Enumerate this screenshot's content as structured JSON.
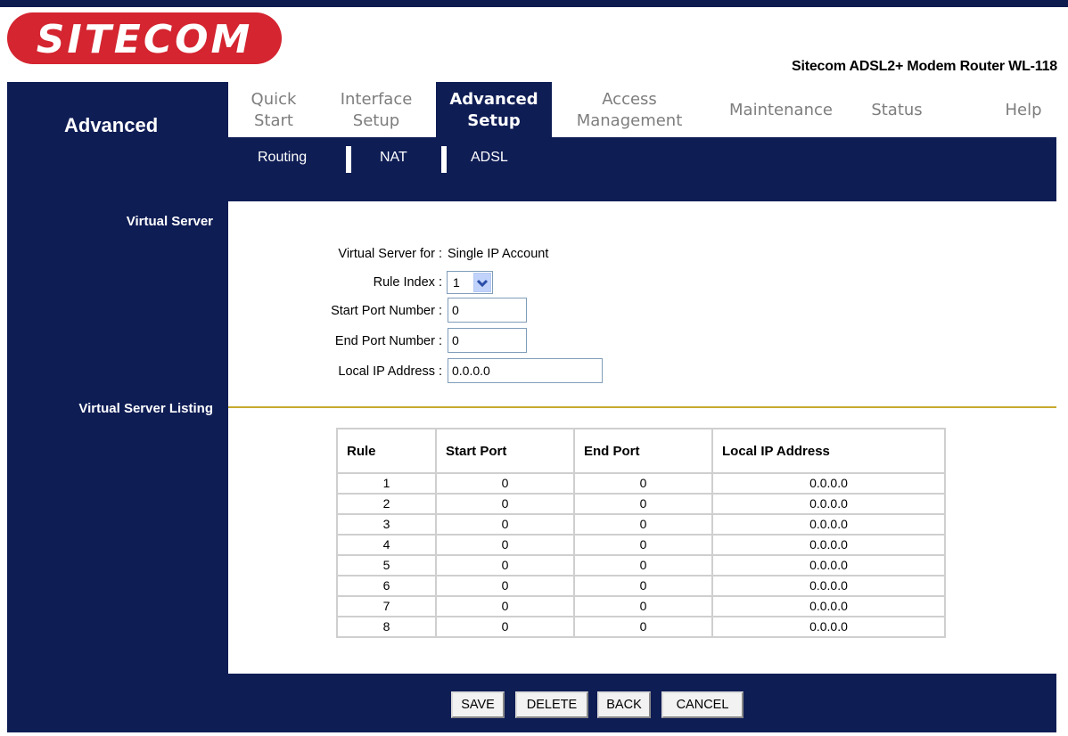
{
  "brand": {
    "logo_text": "SITECOM",
    "product_name": "Sitecom ADSL2+ Modem Router WL-118"
  },
  "section_title": "Advanced",
  "tabs": [
    {
      "line1": "Quick",
      "line2": "Start"
    },
    {
      "line1": "Interface",
      "line2": "Setup"
    },
    {
      "line1": "Advanced",
      "line2": "Setup"
    },
    {
      "line1": "Access",
      "line2": "Management"
    },
    {
      "line1": "Maintenance",
      "line2": ""
    },
    {
      "line1": "Status",
      "line2": ""
    },
    {
      "line1": "Help",
      "line2": ""
    }
  ],
  "subtabs": [
    "Routing",
    "NAT",
    "ADSL"
  ],
  "virtual_server": {
    "heading": "Virtual Server",
    "for_label": "Virtual Server for :",
    "for_value": "Single IP Account",
    "rule_index_label": "Rule Index :",
    "rule_index_value": "1",
    "start_port_label": "Start Port Number :",
    "start_port_value": "0",
    "end_port_label": "End Port Number :",
    "end_port_value": "0",
    "local_ip_label": "Local IP Address :",
    "local_ip_value": "0.0.0.0"
  },
  "listing": {
    "heading": "Virtual Server Listing",
    "columns": [
      "Rule",
      "Start Port",
      "End Port",
      "Local IP Address"
    ],
    "rows": [
      [
        "1",
        "0",
        "0",
        "0.0.0.0"
      ],
      [
        "2",
        "0",
        "0",
        "0.0.0.0"
      ],
      [
        "3",
        "0",
        "0",
        "0.0.0.0"
      ],
      [
        "4",
        "0",
        "0",
        "0.0.0.0"
      ],
      [
        "5",
        "0",
        "0",
        "0.0.0.0"
      ],
      [
        "6",
        "0",
        "0",
        "0.0.0.0"
      ],
      [
        "7",
        "0",
        "0",
        "0.0.0.0"
      ],
      [
        "8",
        "0",
        "0",
        "0.0.0.0"
      ]
    ]
  },
  "buttons": {
    "save": "SAVE",
    "delete": "DELETE",
    "back": "BACK",
    "cancel": "CANCEL"
  },
  "colors": {
    "navy": "#0f1d55",
    "brand_red": "#d42530",
    "divider_gold": "#c7aa2e"
  },
  "icons": {
    "dropdown": "chevron-down-icon"
  }
}
